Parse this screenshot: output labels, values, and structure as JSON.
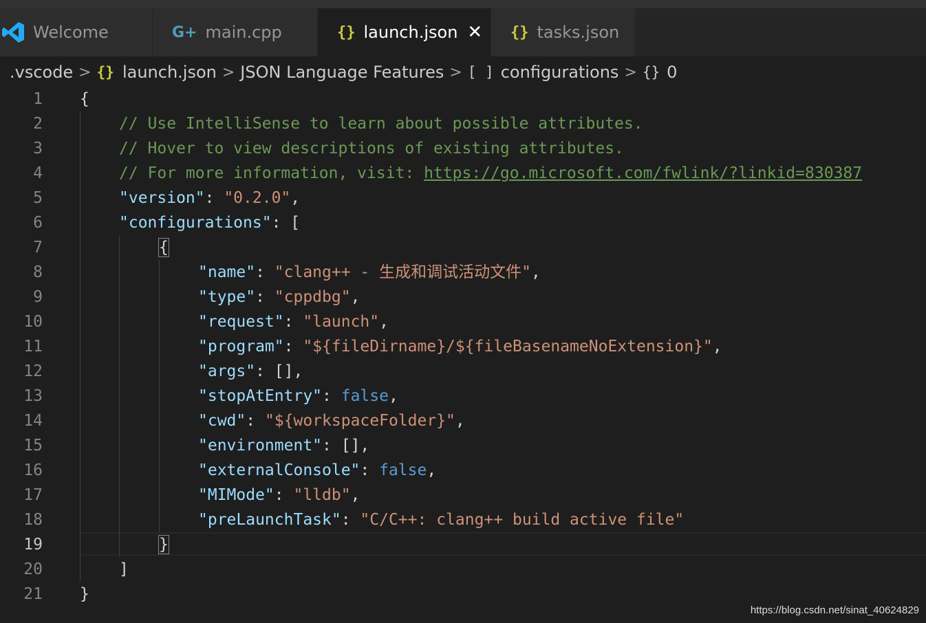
{
  "window": {
    "title": "launch.json"
  },
  "tabs": [
    {
      "label": "Welcome",
      "icon": "vscode-logo-icon",
      "active": false
    },
    {
      "label": "main.cpp",
      "icon": "cpp-file-icon",
      "active": false
    },
    {
      "label": "launch.json",
      "icon": "json-file-icon",
      "active": true
    },
    {
      "label": "tasks.json",
      "icon": "json-file-icon",
      "active": false
    }
  ],
  "icons": {
    "cpp_glyph": "G+",
    "json_glyph": "{}",
    "close_glyph": "✕",
    "sep_glyph": ">",
    "array_glyph": "[ ]",
    "object_glyph": "{}"
  },
  "breadcrumb": {
    "items": [
      ".vscode",
      "launch.json",
      "JSON Language Features",
      "configurations",
      "0"
    ]
  },
  "editor": {
    "line_numbers": [
      "1",
      "2",
      "3",
      "4",
      "5",
      "6",
      "7",
      "8",
      "9",
      "10",
      "11",
      "12",
      "13",
      "14",
      "15",
      "16",
      "17",
      "18",
      "19",
      "20",
      "21"
    ],
    "current_line": 19,
    "comments": {
      "line2": "// Use IntelliSense to learn about possible attributes.",
      "line3": "// Hover to view descriptions of existing attributes.",
      "line4": "// For more information, visit: ",
      "link": "https://go.microsoft.com/fwlink/?linkid=830387"
    },
    "keys": {
      "version": "\"version\"",
      "configurations": "\"configurations\"",
      "name": "\"name\"",
      "type": "\"type\"",
      "request": "\"request\"",
      "program": "\"program\"",
      "args": "\"args\"",
      "stopAtEntry": "\"stopAtEntry\"",
      "cwd": "\"cwd\"",
      "environment": "\"environment\"",
      "externalConsole": "\"externalConsole\"",
      "MIMode": "\"MIMode\"",
      "preLaunchTask": "\"preLaunchTask\""
    },
    "values": {
      "version": "\"0.2.0\"",
      "name": "\"clang++ - 生成和调试活动文件\"",
      "type": "\"cppdbg\"",
      "request": "\"launch\"",
      "program": "\"${fileDirname}/${fileBasenameNoExtension}\"",
      "args": "[]",
      "stopAtEntry": "false",
      "cwd": "\"${workspaceFolder}\"",
      "environment": "[]",
      "externalConsole": "false",
      "MIMode": "\"lldb\"",
      "preLaunchTask": "\"C/C++: clang++ build active file\""
    },
    "punctuation": {
      "open_brace": "{",
      "close_brace": "}",
      "open_bracket": "[",
      "close_bracket": "]",
      "colon": ": ",
      "comma": ","
    }
  },
  "watermark": "https://blog.csdn.net/sinat_40624829",
  "colors": {
    "background": "#1e1e1e",
    "comment": "#6a9955",
    "key": "#9cdcfe",
    "string": "#ce9178",
    "boolean": "#569cd6",
    "json_icon": "#cbcb41",
    "cpp_icon": "#519aba",
    "vscode_blue": "#23a9f2"
  }
}
